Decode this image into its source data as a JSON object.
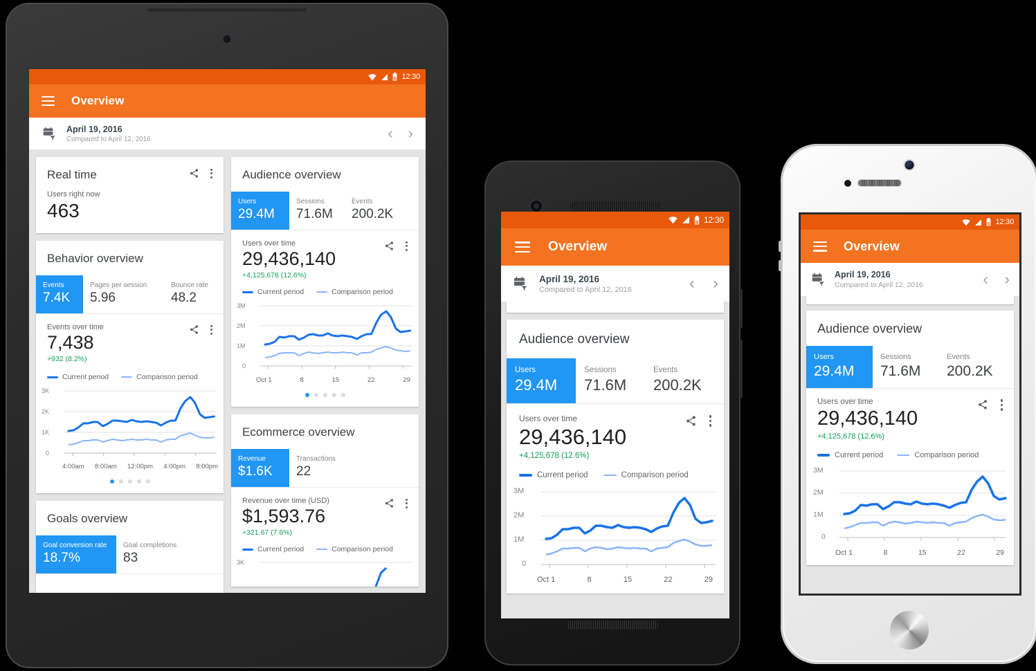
{
  "app": {
    "title": "Overview",
    "menu_icon": "hamburger-menu-icon",
    "brand_color": "#f37321",
    "statusbar_color": "#e8590c",
    "accent_color": "#2196f3",
    "positive_color": "#0f9d58"
  },
  "statusbar": {
    "time": "12:30",
    "wifi_icon": "wifi-icon",
    "signal_icon": "cellular-signal-icon",
    "battery_icon": "battery-icon"
  },
  "datebar": {
    "calendar_icon": "calendar-filter-icon",
    "date": "April 19, 2016",
    "compare": "Compared to April 12, 2016",
    "prev_label": "‹",
    "next_label": "›"
  },
  "icons": {
    "share": "share-icon",
    "more": "more-vertical-icon"
  },
  "legend": {
    "current": "Current period",
    "comparison": "Comparison period"
  },
  "cards": {
    "realtime": {
      "title": "Real time",
      "label": "Users right now",
      "value": "463"
    },
    "behavior": {
      "title": "Behavior overview",
      "metrics": [
        {
          "label": "Events",
          "value": "7.4K",
          "selected": true
        },
        {
          "label": "Pages per session",
          "value": "5.96",
          "selected": false
        },
        {
          "label": "Bounce rate",
          "value": "48.2",
          "selected": false
        }
      ],
      "chart_label": "Events over time",
      "chart_value": "7,438",
      "chart_delta": "+932 (8.2%)",
      "dots": 5,
      "dot_active": 0
    },
    "goals": {
      "title": "Goals overview",
      "metrics": [
        {
          "label": "Goal conversion rate",
          "value": "18.7%",
          "selected": true
        },
        {
          "label": "Goal completions",
          "value": "83",
          "selected": false
        }
      ]
    },
    "audience": {
      "title": "Audience overview",
      "metrics": [
        {
          "label": "Users",
          "value": "29.4M",
          "selected": true
        },
        {
          "label": "Sessions",
          "value": "71.6M",
          "selected": false
        },
        {
          "label": "Events",
          "value": "200.2K",
          "selected": false
        }
      ],
      "chart_label": "Users over time",
      "chart_value": "29,436,140",
      "chart_delta": "+4,125,678 (12.6%)",
      "dots": 5,
      "dot_active": 0
    },
    "ecommerce": {
      "title": "Ecommerce overview",
      "metrics": [
        {
          "label": "Revenue",
          "value": "$1.6K",
          "selected": true
        },
        {
          "label": "Transactions",
          "value": "22",
          "selected": false
        }
      ],
      "chart_label": "Revenue over time (USD)",
      "chart_value": "$1,593.76",
      "chart_delta": "+321.67 (7.6%)"
    }
  },
  "chart_data": [
    {
      "id": "users-over-time",
      "type": "line",
      "title": "Users over time",
      "xlabel": "",
      "ylabel": "",
      "ylim": [
        0,
        3000000
      ],
      "yticks": [
        0,
        1000000,
        2000000,
        3000000
      ],
      "ytick_labels": [
        "0",
        "1M",
        "2M",
        "3M"
      ],
      "xtick_labels": [
        "Oct 1",
        "8",
        "15",
        "22",
        "29"
      ],
      "xtick_indices": [
        0,
        7,
        14,
        21,
        28
      ],
      "grid": true,
      "legend_position": "top-left",
      "series": [
        {
          "name": "Current period",
          "color": "#1a73e8",
          "values": [
            1070000,
            1100000,
            1230000,
            1440000,
            1430000,
            1490000,
            1490000,
            1300000,
            1400000,
            1550000,
            1570000,
            1530000,
            1520000,
            1590000,
            1530000,
            1510000,
            1540000,
            1510000,
            1480000,
            1340000,
            1470000,
            1570000,
            1590000,
            2150000,
            2530000,
            2720000,
            2450000,
            1870000,
            1710000,
            1720000,
            1760000
          ]
        },
        {
          "name": "Comparison period",
          "color": "#8ab4f8",
          "values": [
            400000,
            440000,
            520000,
            600000,
            620000,
            640000,
            620000,
            530000,
            610000,
            660000,
            640000,
            610000,
            630000,
            670000,
            640000,
            630000,
            660000,
            640000,
            620000,
            540000,
            620000,
            650000,
            670000,
            830000,
            900000,
            970000,
            880000,
            790000,
            740000,
            730000,
            760000
          ]
        }
      ]
    },
    {
      "id": "events-over-time",
      "type": "line",
      "title": "Events over time",
      "ylim": [
        0,
        3000
      ],
      "yticks": [
        0,
        1000,
        2000,
        3000
      ],
      "ytick_labels": [
        "0",
        "1K",
        "2K",
        "3K"
      ],
      "xtick_labels": [
        "4:00am",
        "8:00am",
        "12:00pm",
        "4:00pm",
        "8:00pm"
      ],
      "xtick_indices": [
        1,
        7,
        13,
        19,
        25
      ],
      "grid": true,
      "legend_position": "top-left",
      "series": [
        {
          "name": "Current period",
          "color": "#1a73e8",
          "values": [
            1070000,
            1100000,
            1230000,
            1440000,
            1430000,
            1490000,
            1490000,
            1300000,
            1400000,
            1550000,
            1570000,
            1530000,
            1520000,
            1590000,
            1530000,
            1510000,
            1540000,
            1510000,
            1480000,
            1340000,
            1470000,
            1570000,
            1590000,
            2150000,
            2530000,
            2720000,
            2450000,
            1870000,
            1710000,
            1720000,
            1760000
          ]
        },
        {
          "name": "Comparison period",
          "color": "#8ab4f8",
          "values": [
            400000,
            440000,
            520000,
            600000,
            620000,
            640000,
            620000,
            530000,
            610000,
            660000,
            640000,
            610000,
            630000,
            670000,
            640000,
            630000,
            660000,
            640000,
            620000,
            540000,
            620000,
            650000,
            670000,
            830000,
            900000,
            970000,
            880000,
            790000,
            740000,
            730000,
            760000
          ]
        }
      ]
    }
  ]
}
